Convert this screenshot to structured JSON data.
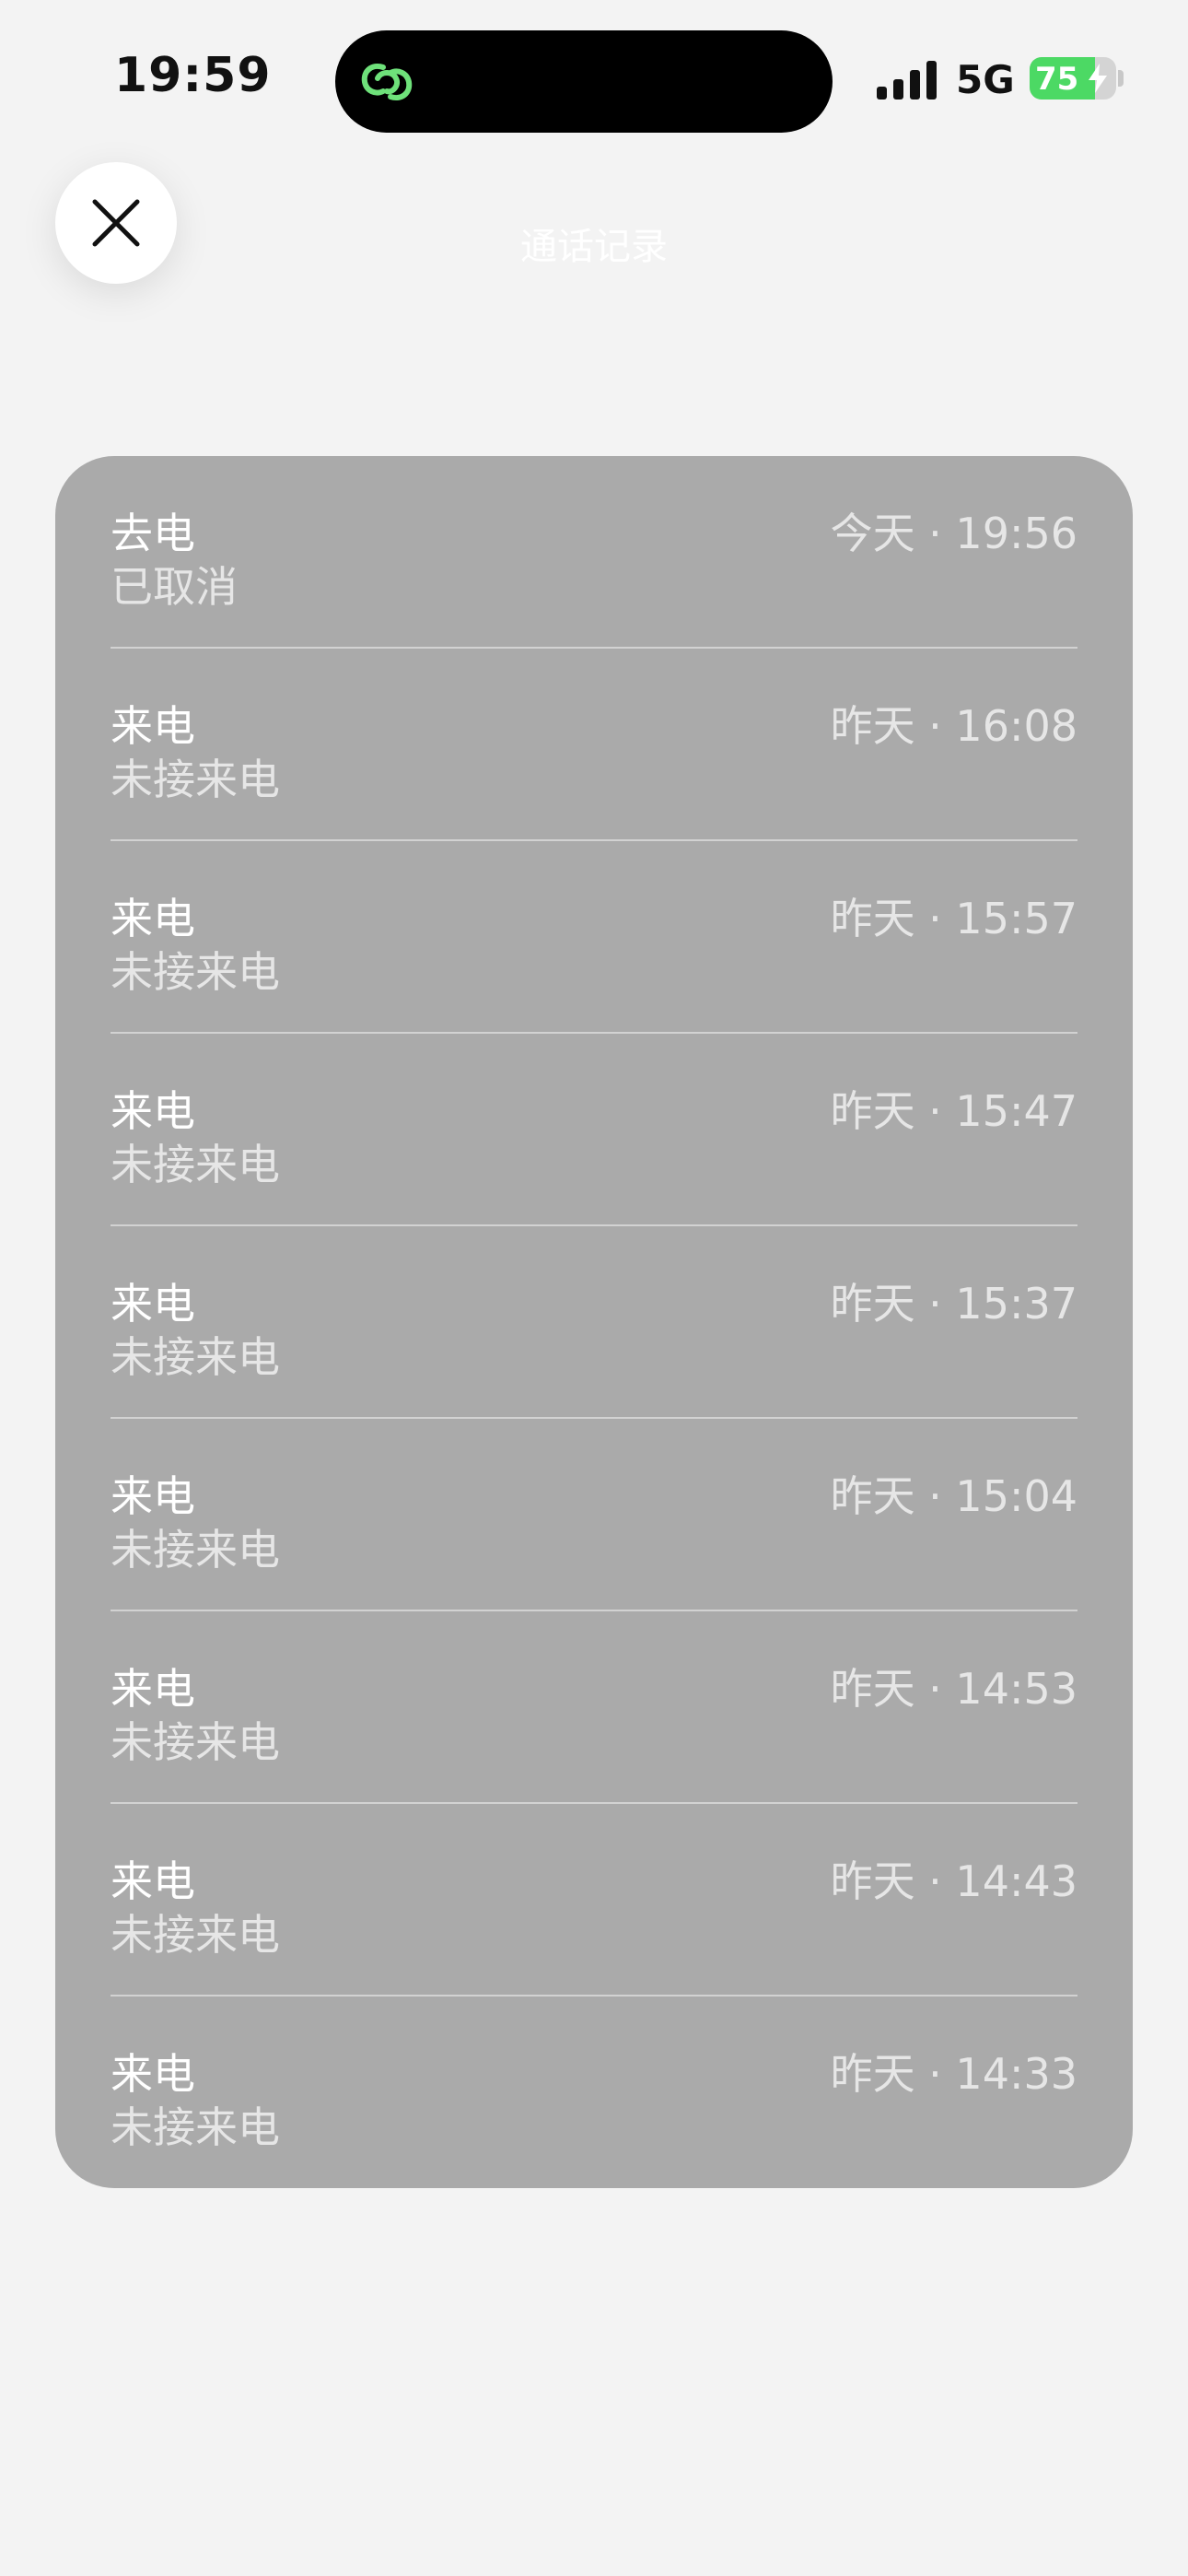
{
  "status_bar": {
    "time": "19:59",
    "network": "5G",
    "battery_level": "75",
    "battery_fraction": 0.75,
    "battery_color": "#4cd964",
    "island_icon": "link-app-icon",
    "island_icon_color": "#6ee17a"
  },
  "header": {
    "close_icon": "close-icon",
    "title": "通话记录"
  },
  "calls": [
    {
      "type": "去电",
      "status": "已取消",
      "time": "今天 · 19:56"
    },
    {
      "type": "来电",
      "status": "未接来电",
      "time": "昨天 · 16:08"
    },
    {
      "type": "来电",
      "status": "未接来电",
      "time": "昨天 · 15:57"
    },
    {
      "type": "来电",
      "status": "未接来电",
      "time": "昨天 · 15:47"
    },
    {
      "type": "来电",
      "status": "未接来电",
      "time": "昨天 · 15:37"
    },
    {
      "type": "来电",
      "status": "未接来电",
      "time": "昨天 · 15:04"
    },
    {
      "type": "来电",
      "status": "未接来电",
      "time": "昨天 · 14:53"
    },
    {
      "type": "来电",
      "status": "未接来电",
      "time": "昨天 · 14:43"
    },
    {
      "type": "来电",
      "status": "未接来电",
      "time": "昨天 · 14:33"
    }
  ]
}
